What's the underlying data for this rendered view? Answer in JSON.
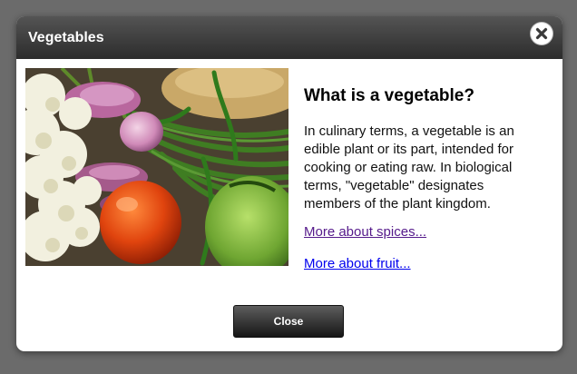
{
  "dialog": {
    "title": "Vegetables",
    "close_icon": "close-icon",
    "close_button_label": "Close"
  },
  "content": {
    "heading": "What is a vegetable?",
    "paragraph": "In culinary terms, a vegetable is an edible plant or its part, intended for cooking or eating raw. In biological terms, \"vegetable\" designates members of the plant kingdom.",
    "links": [
      {
        "label": "More about spices...",
        "color": "#551a8b"
      },
      {
        "label": "More about fruit...",
        "color": "#0000ee"
      }
    ]
  },
  "colors": {
    "overlay": "#6b6b6b",
    "titlebar": "#3a3a3a",
    "visited_link": "#551a8b",
    "link": "#0000ee"
  }
}
